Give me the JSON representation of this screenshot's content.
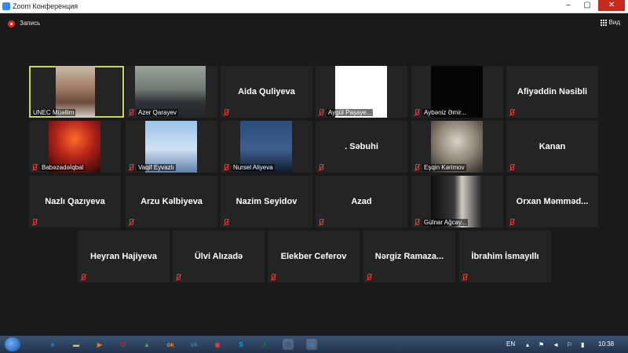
{
  "window": {
    "title": "Zoom Конференция"
  },
  "toolbar": {
    "record_label": "Запись",
    "view_label": "Вид"
  },
  "participants": [
    {
      "name": "UNEC Müəllim",
      "display": "video",
      "active": true
    },
    {
      "name": "Azer Qarayev",
      "display": "video"
    },
    {
      "name": "Aida Quliyeva",
      "display": "name"
    },
    {
      "name": "Aygül Paşaye...",
      "display": "video"
    },
    {
      "name": "Aybəniz Əmir...",
      "display": "video"
    },
    {
      "name": "Afiyəddin Nəsibli",
      "display": "name"
    },
    {
      "name": "Babəzadəİqbal",
      "display": "video"
    },
    {
      "name": "Vaqif Eyvazlı",
      "display": "video"
    },
    {
      "name": "Nursel Aliyeva",
      "display": "video"
    },
    {
      "name": ". Səbuhi",
      "display": "name"
    },
    {
      "name": "Eşqin Kərimov",
      "display": "video"
    },
    {
      "name": "Kanan",
      "display": "name"
    },
    {
      "name": "Nazlı Qazıyeva",
      "display": "name"
    },
    {
      "name": "Arzu Kəlbiyeva",
      "display": "name"
    },
    {
      "name": "Nazim Seyidov",
      "display": "name"
    },
    {
      "name": "Azad",
      "display": "name"
    },
    {
      "name": "Gülnar Ağcay...",
      "display": "video"
    },
    {
      "name": "Orxan  Məmməd...",
      "display": "name"
    },
    {
      "name": "Heyran Hajiyeva",
      "display": "name"
    },
    {
      "name": "Ülvi Alızadə",
      "display": "name"
    },
    {
      "name": "Elekber Ceferov",
      "display": "name"
    },
    {
      "name": "Nərgiz  Ramaza...",
      "display": "name"
    },
    {
      "name": "İbrahim İsmayıllı",
      "display": "name"
    }
  ],
  "taskbar": {
    "language": "EN",
    "clock": "10:38",
    "apps": [
      "ie-icon",
      "explorer-icon",
      "media-icon",
      "opera-icon",
      "android-icon",
      "odnoklassniki-icon",
      "vk-icon",
      "chrome-icon",
      "skype-icon",
      "excel-icon",
      "word-icon",
      "zoom-icon"
    ]
  },
  "colors": {
    "active_outline": "#c6d84e",
    "muted_mic": "#e23b3b",
    "tile_bg": "#242424",
    "background": "#1a1a1a"
  }
}
